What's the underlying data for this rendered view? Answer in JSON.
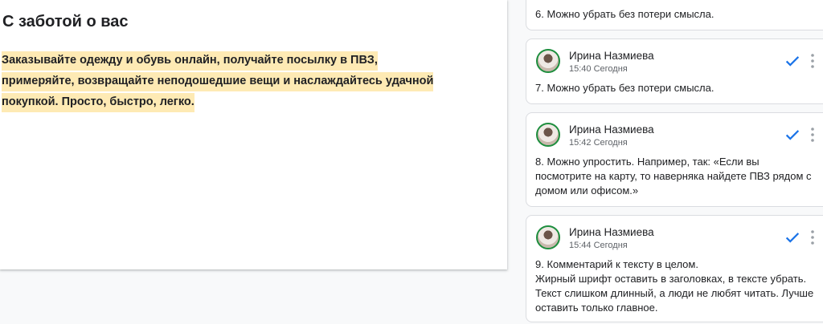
{
  "document": {
    "heading": "С заботой о вас",
    "paragraph_lines": [
      "Заказывайте одежду и обувь онлайн, получайте посылку в ПВЗ,",
      "примеряйте, возвращайте неподошедшие вещи и наслаждайтесь удачной",
      "покупкой. Просто, быстро, легко."
    ],
    "highlight_color": "#feeab4"
  },
  "comments": [
    {
      "author": "",
      "time": "",
      "text_lines": [
        "6. Можно убрать без потери смысла."
      ]
    },
    {
      "author": "Ирина Назмиева",
      "time": "15:40 Сегодня",
      "text_lines": [
        "7. Можно убрать без потери смысла."
      ]
    },
    {
      "author": "Ирина Назмиева",
      "time": "15:42 Сегодня",
      "text_lines": [
        "8. Можно упростить. Например, так: «Если вы",
        "посмотрите на карту, то наверняка найдете ПВЗ рядом с",
        "домом или офисом.»"
      ]
    },
    {
      "author": "Ирина Назмиева",
      "time": "15:44 Сегодня",
      "text_lines": [
        "9. Комментарий к тексту в целом.",
        "Жирный шрифт оставить в заголовках, в тексте убрать.",
        "Текст слишком длинный, а люди не любят читать. Лучше",
        "оставить только главное."
      ]
    }
  ],
  "colors": {
    "resolve_check": "#1a73e8",
    "avatar_ring": "#1e8e3e",
    "card_border": "#dadce0"
  },
  "icons": {
    "resolve": "check-icon",
    "menu": "more-vert-icon"
  }
}
